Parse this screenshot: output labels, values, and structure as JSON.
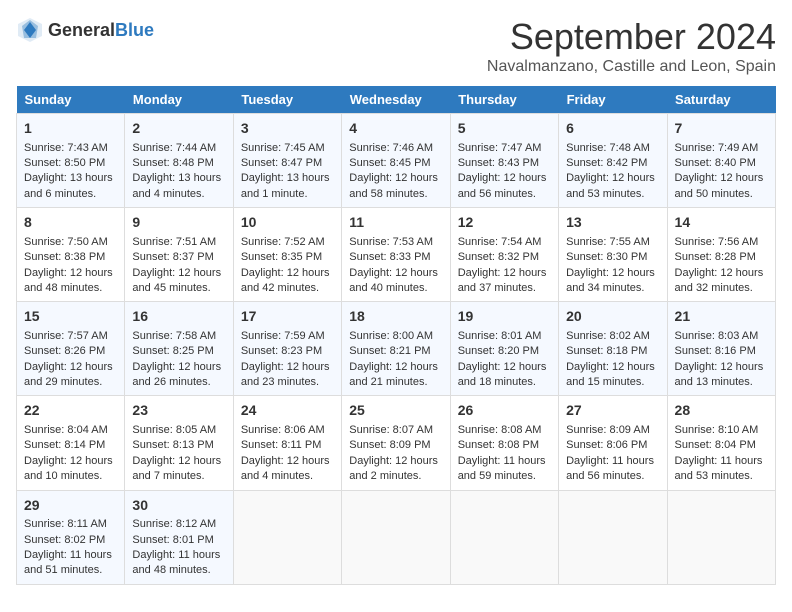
{
  "header": {
    "logo_general": "General",
    "logo_blue": "Blue",
    "title": "September 2024",
    "subtitle": "Navalmanzano, Castille and Leon, Spain"
  },
  "days_of_week": [
    "Sunday",
    "Monday",
    "Tuesday",
    "Wednesday",
    "Thursday",
    "Friday",
    "Saturday"
  ],
  "weeks": [
    [
      {
        "day": "1",
        "sunrise": "Sunrise: 7:43 AM",
        "sunset": "Sunset: 8:50 PM",
        "daylight": "Daylight: 13 hours and 6 minutes."
      },
      {
        "day": "2",
        "sunrise": "Sunrise: 7:44 AM",
        "sunset": "Sunset: 8:48 PM",
        "daylight": "Daylight: 13 hours and 4 minutes."
      },
      {
        "day": "3",
        "sunrise": "Sunrise: 7:45 AM",
        "sunset": "Sunset: 8:47 PM",
        "daylight": "Daylight: 13 hours and 1 minute."
      },
      {
        "day": "4",
        "sunrise": "Sunrise: 7:46 AM",
        "sunset": "Sunset: 8:45 PM",
        "daylight": "Daylight: 12 hours and 58 minutes."
      },
      {
        "day": "5",
        "sunrise": "Sunrise: 7:47 AM",
        "sunset": "Sunset: 8:43 PM",
        "daylight": "Daylight: 12 hours and 56 minutes."
      },
      {
        "day": "6",
        "sunrise": "Sunrise: 7:48 AM",
        "sunset": "Sunset: 8:42 PM",
        "daylight": "Daylight: 12 hours and 53 minutes."
      },
      {
        "day": "7",
        "sunrise": "Sunrise: 7:49 AM",
        "sunset": "Sunset: 8:40 PM",
        "daylight": "Daylight: 12 hours and 50 minutes."
      }
    ],
    [
      {
        "day": "8",
        "sunrise": "Sunrise: 7:50 AM",
        "sunset": "Sunset: 8:38 PM",
        "daylight": "Daylight: 12 hours and 48 minutes."
      },
      {
        "day": "9",
        "sunrise": "Sunrise: 7:51 AM",
        "sunset": "Sunset: 8:37 PM",
        "daylight": "Daylight: 12 hours and 45 minutes."
      },
      {
        "day": "10",
        "sunrise": "Sunrise: 7:52 AM",
        "sunset": "Sunset: 8:35 PM",
        "daylight": "Daylight: 12 hours and 42 minutes."
      },
      {
        "day": "11",
        "sunrise": "Sunrise: 7:53 AM",
        "sunset": "Sunset: 8:33 PM",
        "daylight": "Daylight: 12 hours and 40 minutes."
      },
      {
        "day": "12",
        "sunrise": "Sunrise: 7:54 AM",
        "sunset": "Sunset: 8:32 PM",
        "daylight": "Daylight: 12 hours and 37 minutes."
      },
      {
        "day": "13",
        "sunrise": "Sunrise: 7:55 AM",
        "sunset": "Sunset: 8:30 PM",
        "daylight": "Daylight: 12 hours and 34 minutes."
      },
      {
        "day": "14",
        "sunrise": "Sunrise: 7:56 AM",
        "sunset": "Sunset: 8:28 PM",
        "daylight": "Daylight: 12 hours and 32 minutes."
      }
    ],
    [
      {
        "day": "15",
        "sunrise": "Sunrise: 7:57 AM",
        "sunset": "Sunset: 8:26 PM",
        "daylight": "Daylight: 12 hours and 29 minutes."
      },
      {
        "day": "16",
        "sunrise": "Sunrise: 7:58 AM",
        "sunset": "Sunset: 8:25 PM",
        "daylight": "Daylight: 12 hours and 26 minutes."
      },
      {
        "day": "17",
        "sunrise": "Sunrise: 7:59 AM",
        "sunset": "Sunset: 8:23 PM",
        "daylight": "Daylight: 12 hours and 23 minutes."
      },
      {
        "day": "18",
        "sunrise": "Sunrise: 8:00 AM",
        "sunset": "Sunset: 8:21 PM",
        "daylight": "Daylight: 12 hours and 21 minutes."
      },
      {
        "day": "19",
        "sunrise": "Sunrise: 8:01 AM",
        "sunset": "Sunset: 8:20 PM",
        "daylight": "Daylight: 12 hours and 18 minutes."
      },
      {
        "day": "20",
        "sunrise": "Sunrise: 8:02 AM",
        "sunset": "Sunset: 8:18 PM",
        "daylight": "Daylight: 12 hours and 15 minutes."
      },
      {
        "day": "21",
        "sunrise": "Sunrise: 8:03 AM",
        "sunset": "Sunset: 8:16 PM",
        "daylight": "Daylight: 12 hours and 13 minutes."
      }
    ],
    [
      {
        "day": "22",
        "sunrise": "Sunrise: 8:04 AM",
        "sunset": "Sunset: 8:14 PM",
        "daylight": "Daylight: 12 hours and 10 minutes."
      },
      {
        "day": "23",
        "sunrise": "Sunrise: 8:05 AM",
        "sunset": "Sunset: 8:13 PM",
        "daylight": "Daylight: 12 hours and 7 minutes."
      },
      {
        "day": "24",
        "sunrise": "Sunrise: 8:06 AM",
        "sunset": "Sunset: 8:11 PM",
        "daylight": "Daylight: 12 hours and 4 minutes."
      },
      {
        "day": "25",
        "sunrise": "Sunrise: 8:07 AM",
        "sunset": "Sunset: 8:09 PM",
        "daylight": "Daylight: 12 hours and 2 minutes."
      },
      {
        "day": "26",
        "sunrise": "Sunrise: 8:08 AM",
        "sunset": "Sunset: 8:08 PM",
        "daylight": "Daylight: 11 hours and 59 minutes."
      },
      {
        "day": "27",
        "sunrise": "Sunrise: 8:09 AM",
        "sunset": "Sunset: 8:06 PM",
        "daylight": "Daylight: 11 hours and 56 minutes."
      },
      {
        "day": "28",
        "sunrise": "Sunrise: 8:10 AM",
        "sunset": "Sunset: 8:04 PM",
        "daylight": "Daylight: 11 hours and 53 minutes."
      }
    ],
    [
      {
        "day": "29",
        "sunrise": "Sunrise: 8:11 AM",
        "sunset": "Sunset: 8:02 PM",
        "daylight": "Daylight: 11 hours and 51 minutes."
      },
      {
        "day": "30",
        "sunrise": "Sunrise: 8:12 AM",
        "sunset": "Sunset: 8:01 PM",
        "daylight": "Daylight: 11 hours and 48 minutes."
      },
      null,
      null,
      null,
      null,
      null
    ]
  ]
}
